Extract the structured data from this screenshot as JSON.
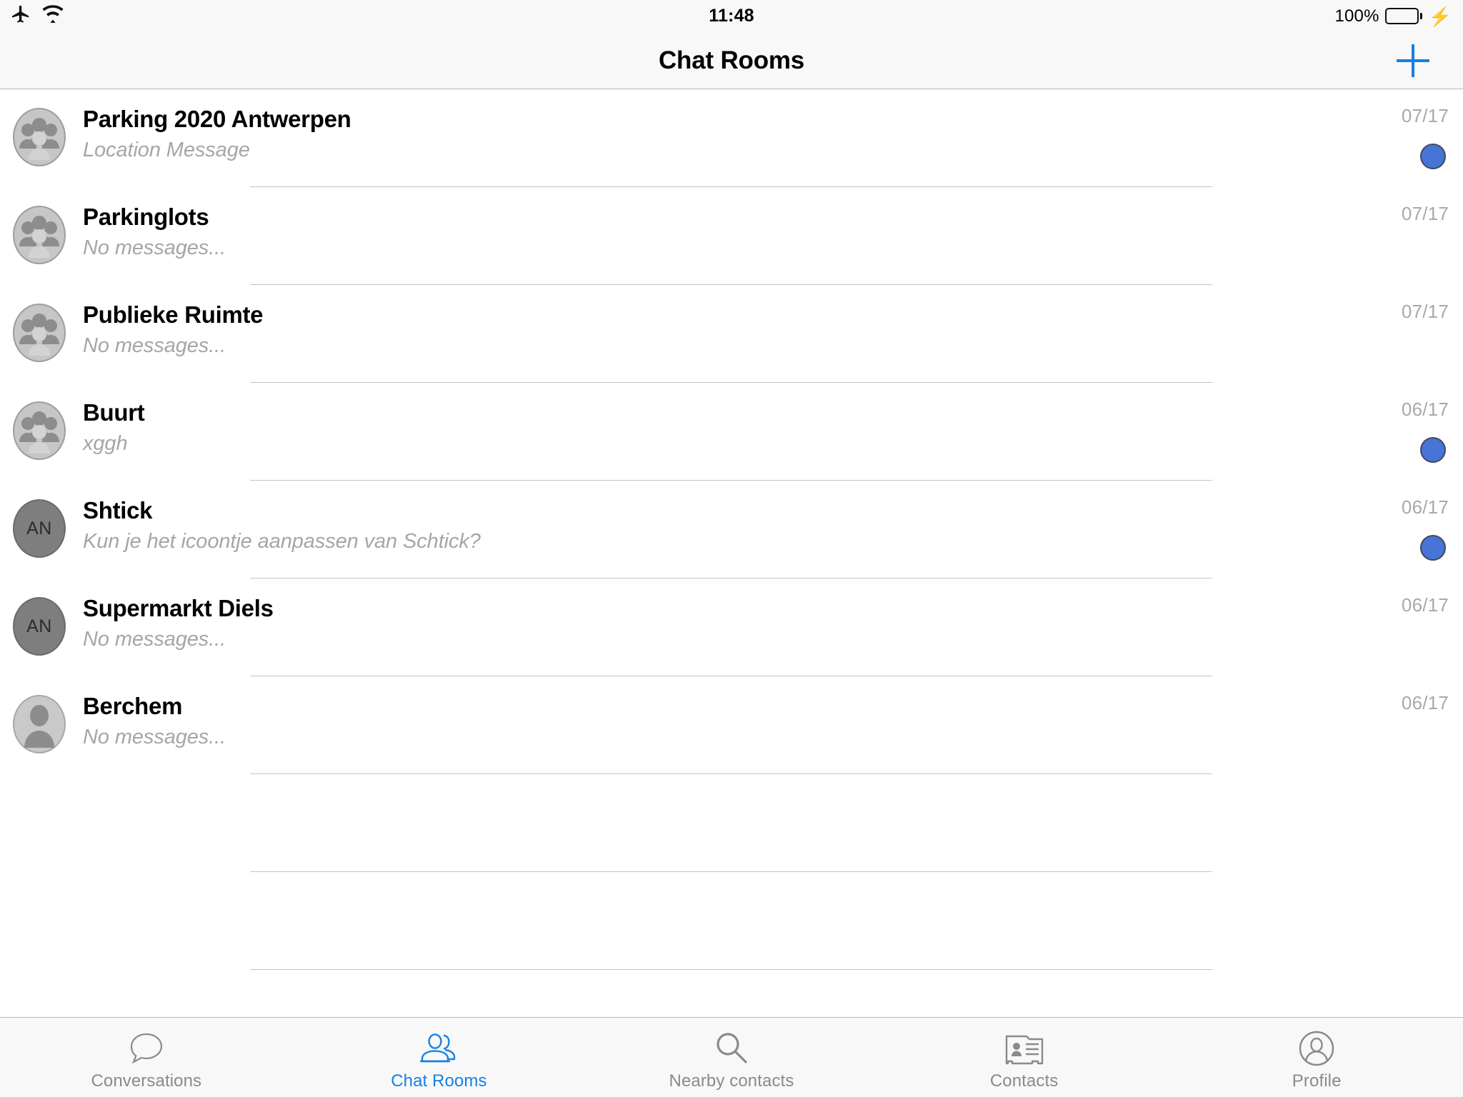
{
  "status_bar": {
    "airplane_icon": "airplane-mode-icon",
    "wifi_icon": "wifi-icon",
    "time": "11:48",
    "battery_percent": "100%",
    "battery_icon": "battery-full-icon",
    "charging_icon": "lightning-bolt-icon",
    "battery_color": "#4CD964"
  },
  "nav_bar": {
    "title": "Chat Rooms",
    "add_button_icon": "plus-icon",
    "accent_color": "#1481E8"
  },
  "list": {
    "rows": [
      {
        "title": "Parking 2020 Antwerpen",
        "subtitle": "Location Message",
        "date": "07/17",
        "unread": true,
        "avatar_type": "group",
        "avatar_initials": ""
      },
      {
        "title": "Parkinglots",
        "subtitle": "No messages...",
        "date": "07/17",
        "unread": false,
        "avatar_type": "group",
        "avatar_initials": ""
      },
      {
        "title": "Publieke Ruimte",
        "subtitle": "No messages...",
        "date": "07/17",
        "unread": false,
        "avatar_type": "group",
        "avatar_initials": ""
      },
      {
        "title": "Buurt",
        "subtitle": "xggh",
        "date": "06/17",
        "unread": true,
        "avatar_type": "group",
        "avatar_initials": ""
      },
      {
        "title": "Shtick",
        "subtitle": "Kun je het icoontje aanpassen van Schtick?",
        "date": "06/17",
        "unread": true,
        "avatar_type": "initials",
        "avatar_initials": "AN"
      },
      {
        "title": "Supermarkt Diels",
        "subtitle": "No messages...",
        "date": "06/17",
        "unread": false,
        "avatar_type": "initials",
        "avatar_initials": "AN"
      },
      {
        "title": "Berchem",
        "subtitle": "No messages...",
        "date": "06/17",
        "unread": false,
        "avatar_type": "person",
        "avatar_initials": ""
      },
      {
        "title": "",
        "subtitle": "",
        "date": "",
        "unread": false,
        "avatar_type": "none",
        "avatar_initials": ""
      },
      {
        "title": "",
        "subtitle": "",
        "date": "",
        "unread": false,
        "avatar_type": "none",
        "avatar_initials": ""
      },
      {
        "title": "",
        "subtitle": "",
        "date": "",
        "unread": false,
        "avatar_type": "none",
        "avatar_initials": ""
      }
    ],
    "unread_badge_color": "#4874D8",
    "separator_color": "#C3C3C3"
  },
  "tab_bar": {
    "active_color": "#1481E8",
    "inactive_color": "#8A8A8A",
    "tabs": [
      {
        "label": "Conversations",
        "icon": "speech-bubble-icon",
        "active": false
      },
      {
        "label": "Chat Rooms",
        "icon": "two-people-icon",
        "active": true
      },
      {
        "label": "Nearby contacts",
        "icon": "magnifier-icon",
        "active": false
      },
      {
        "label": "Contacts",
        "icon": "address-card-icon",
        "active": false
      },
      {
        "label": "Profile",
        "icon": "person-circle-icon",
        "active": false
      }
    ]
  }
}
